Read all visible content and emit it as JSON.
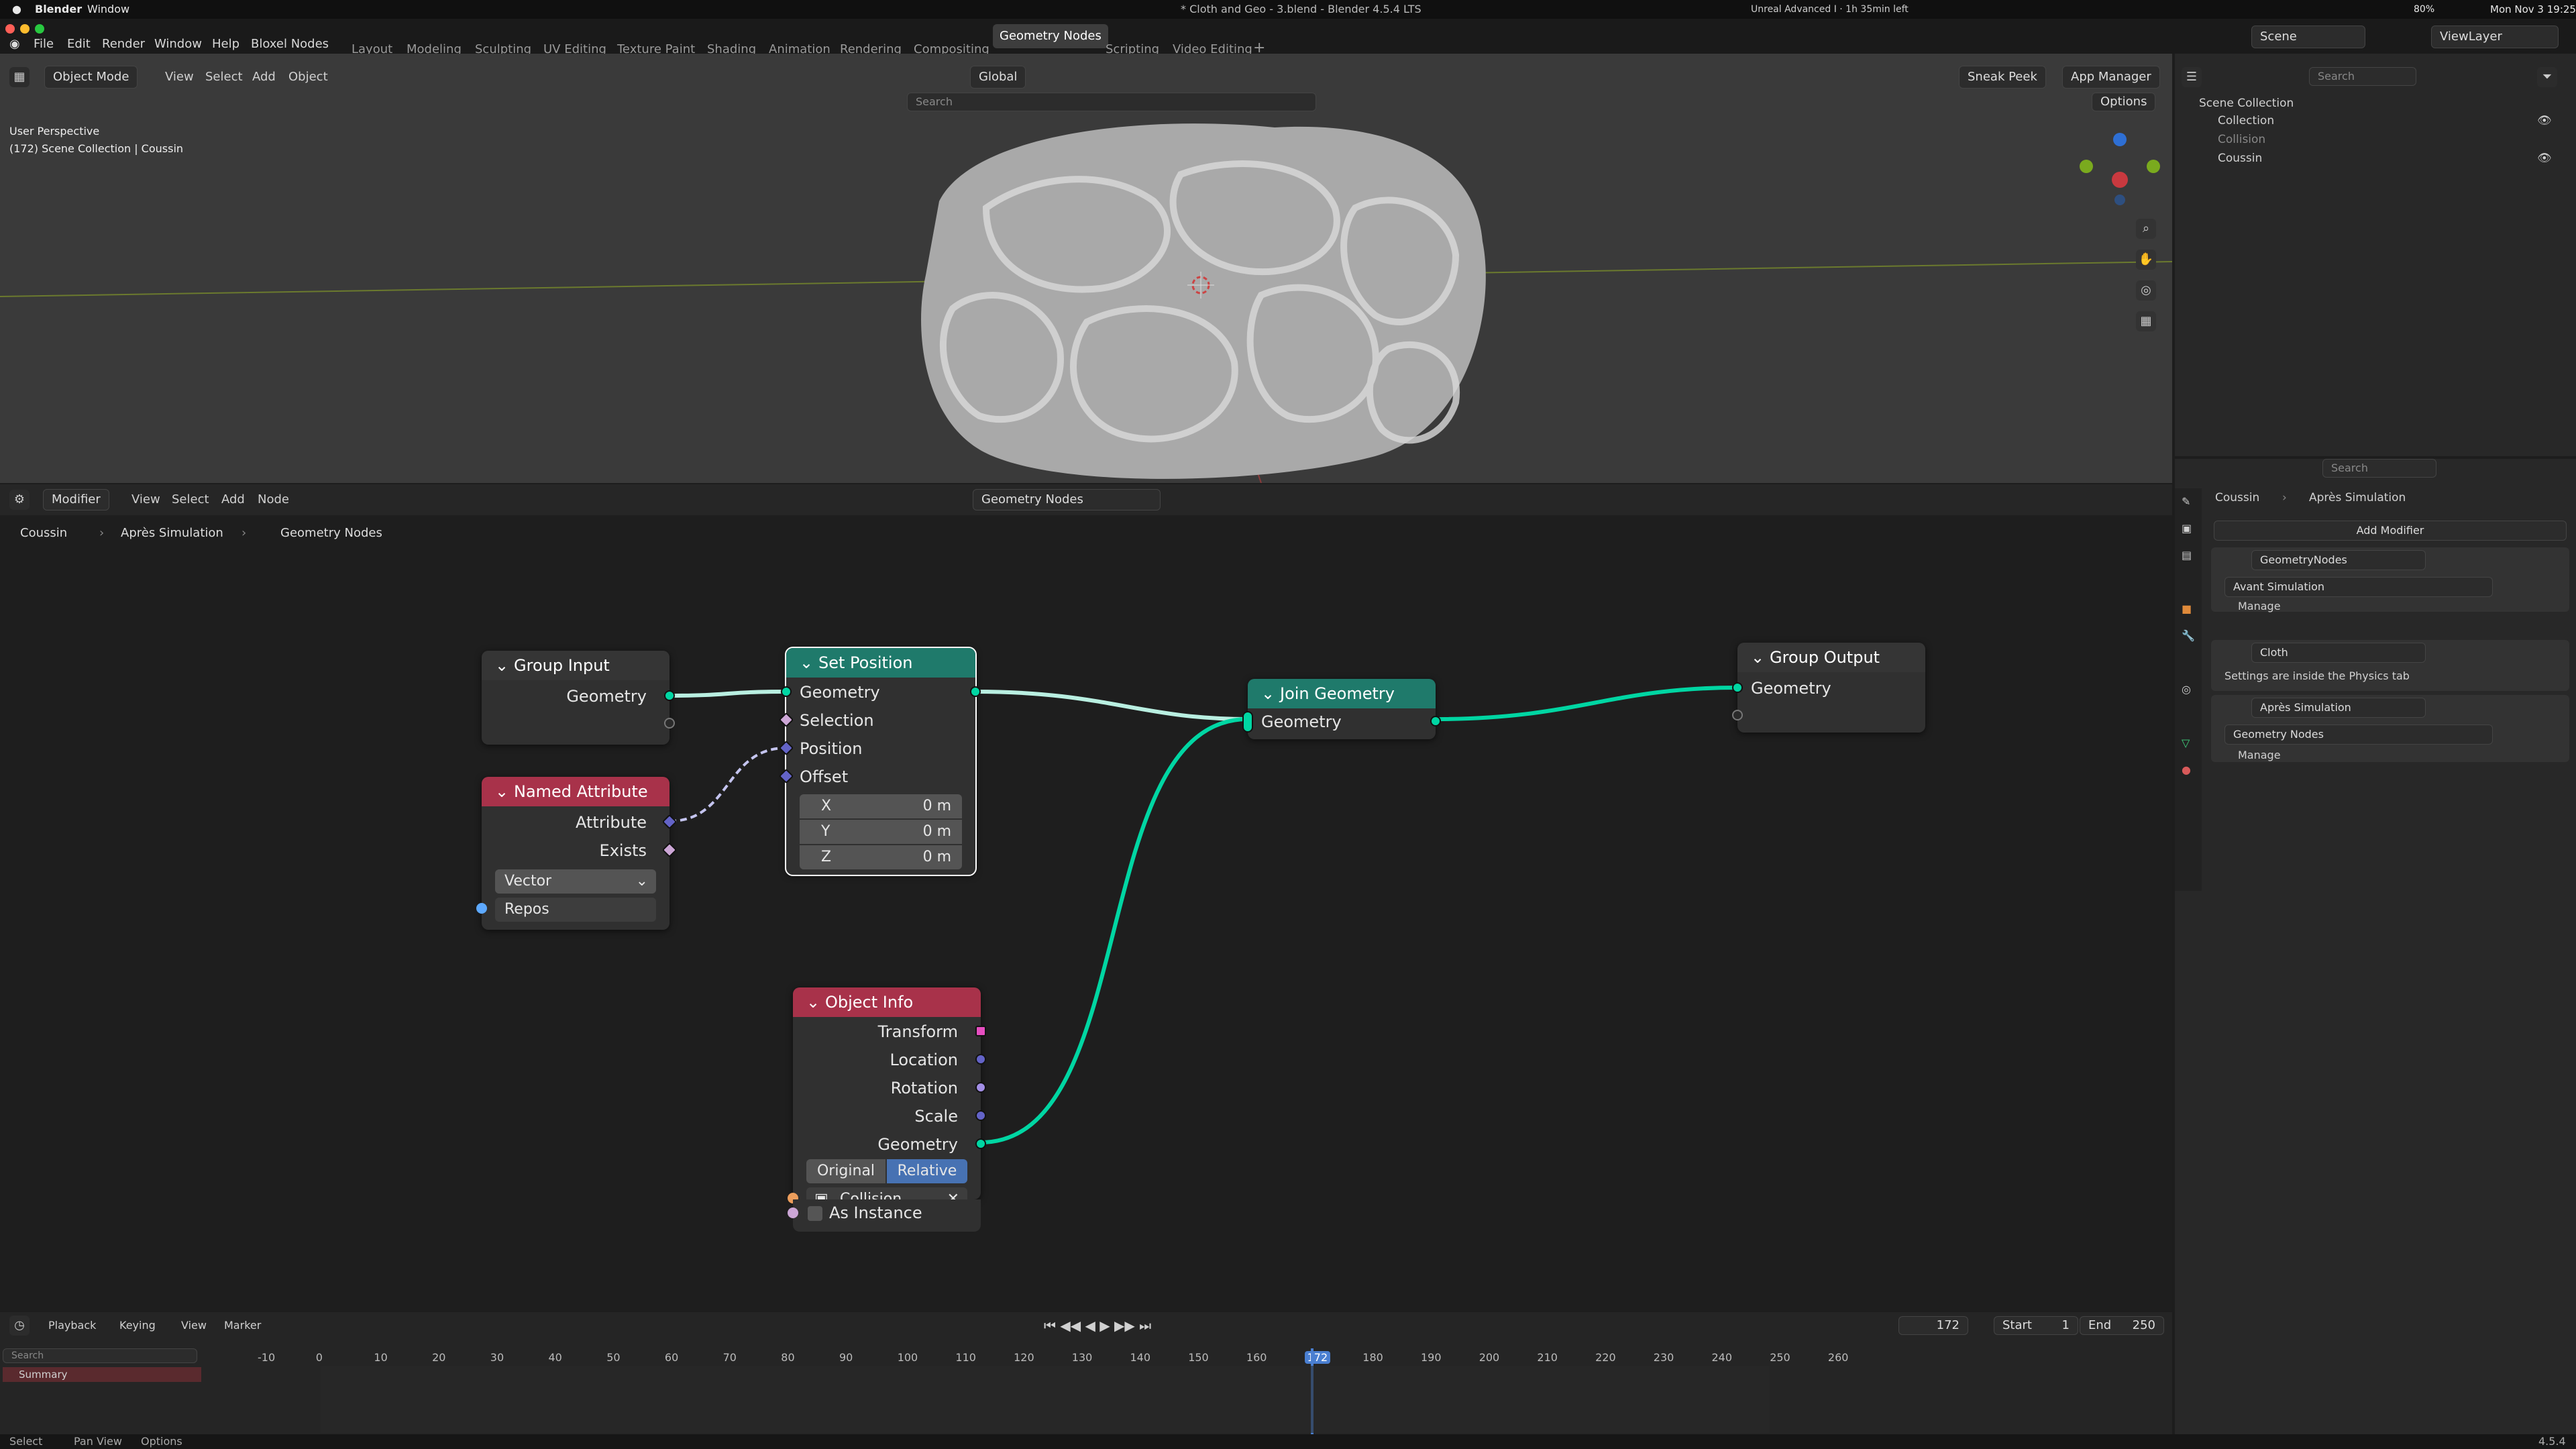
{
  "mac_menubar": {
    "app": "Blender",
    "window_menu": "Window",
    "window_title": "* Cloth and Geo - 3.blend - Blender 4.5.4 LTS",
    "battery_app": "Unreal Advanced I · 1h 35min left",
    "battery": "80%",
    "datetime": "Mon Nov 3  19:25"
  },
  "blender_menu": [
    "File",
    "Edit",
    "Render",
    "Window",
    "Help",
    "Bloxel Nodes"
  ],
  "workspaces": [
    "Layout",
    "Modeling",
    "Sculpting",
    "UV Editing",
    "Texture Paint",
    "Shading",
    "Animation",
    "Rendering",
    "Compositing",
    "Geometry Nodes",
    "Scripting",
    "Video Editing"
  ],
  "active_workspace": "Geometry Nodes",
  "scene": {
    "label": "Scene",
    "view_layer": "ViewLayer"
  },
  "viewport": {
    "mode": "Object Mode",
    "menus": [
      "View",
      "Select",
      "Add",
      "Object"
    ],
    "orientation": "Global",
    "search_placeholder": "Search",
    "sneak_peek": "Sneak Peek",
    "app_manager": "App Manager",
    "options": "Options",
    "perspective": "User Perspective",
    "collection_info": "(172) Scene Collection | Coussin"
  },
  "node_editor": {
    "editor_type": "Modifier",
    "menus": [
      "View",
      "Select",
      "Add",
      "Node"
    ],
    "tree_name": "Geometry Nodes",
    "breadcrumb": [
      "Coussin",
      "Après Simulation",
      "Geometry Nodes"
    ],
    "nodes": {
      "group_input": {
        "title": "Group Input",
        "outputs": [
          "Geometry"
        ]
      },
      "named_attribute": {
        "title": "Named Attribute",
        "outputs": [
          "Attribute",
          "Exists"
        ],
        "data_type": "Vector",
        "name_value": "Repos",
        "color": "#a8324a"
      },
      "set_position": {
        "title": "Set Position",
        "inputs": [
          "Geometry",
          "Selection",
          "Position",
          "Offset"
        ],
        "offset": [
          {
            "axis": "X",
            "value": "0 m"
          },
          {
            "axis": "Y",
            "value": "0 m"
          },
          {
            "axis": "Z",
            "value": "0 m"
          }
        ],
        "color": "#1f7a6b"
      },
      "join_geometry": {
        "title": "Join Geometry",
        "socket": "Geometry",
        "color": "#1f7a6b"
      },
      "group_output": {
        "title": "Group Output",
        "inputs": [
          "Geometry"
        ]
      },
      "object_info": {
        "title": "Object Info",
        "outputs": [
          "Transform",
          "Location",
          "Rotation",
          "Scale",
          "Geometry"
        ],
        "mode_options": [
          "Original",
          "Relative"
        ],
        "mode_selected": "Relative",
        "object": "Collision",
        "as_instance": "As Instance",
        "color": "#a8324a"
      }
    }
  },
  "outliner": {
    "search_placeholder": "Search",
    "items": [
      {
        "label": "Scene Collection"
      },
      {
        "label": "Collection"
      },
      {
        "label": "Collision"
      },
      {
        "label": "Coussin"
      }
    ]
  },
  "properties": {
    "search_placeholder": "Search",
    "object": "Coussin",
    "modifier_path": "Après Simulation",
    "add_modifier": "Add Modifier",
    "modifiers": [
      {
        "name": "GeometryNodes",
        "tree": "Avant Simulation",
        "manage": "Manage"
      },
      {
        "name": "Cloth",
        "note": "Settings are inside the Physics tab"
      },
      {
        "name": "Après Simulation",
        "tree": "Geometry Nodes",
        "manage": "Manage"
      }
    ]
  },
  "timeline": {
    "menus": [
      "Playback",
      "Keying",
      "View",
      "Marker"
    ],
    "current_frame": "172",
    "start_label": "Start",
    "start": "1",
    "end_label": "End",
    "end": "250",
    "search_placeholder": "Search",
    "summary": "Summary",
    "ticks": [
      "-10",
      "0",
      "10",
      "20",
      "30",
      "40",
      "50",
      "60",
      "70",
      "80",
      "90",
      "100",
      "110",
      "120",
      "130",
      "140",
      "150",
      "160",
      "172",
      "180",
      "190",
      "200",
      "210",
      "220",
      "230",
      "240",
      "250",
      "260"
    ]
  },
  "statusbar": {
    "select": "Select",
    "pan": "Pan View",
    "options": "Options",
    "version": "4.5.4"
  },
  "colors": {
    "geometry_socket": "#00d6a3",
    "vector_socket": "#6363c7",
    "bool_socket": "#cca6d6",
    "object_socket": "#ed9e5c",
    "accent": "#4772b3",
    "attr_header": "#a8324a",
    "geo_header": "#1f7a6b"
  }
}
